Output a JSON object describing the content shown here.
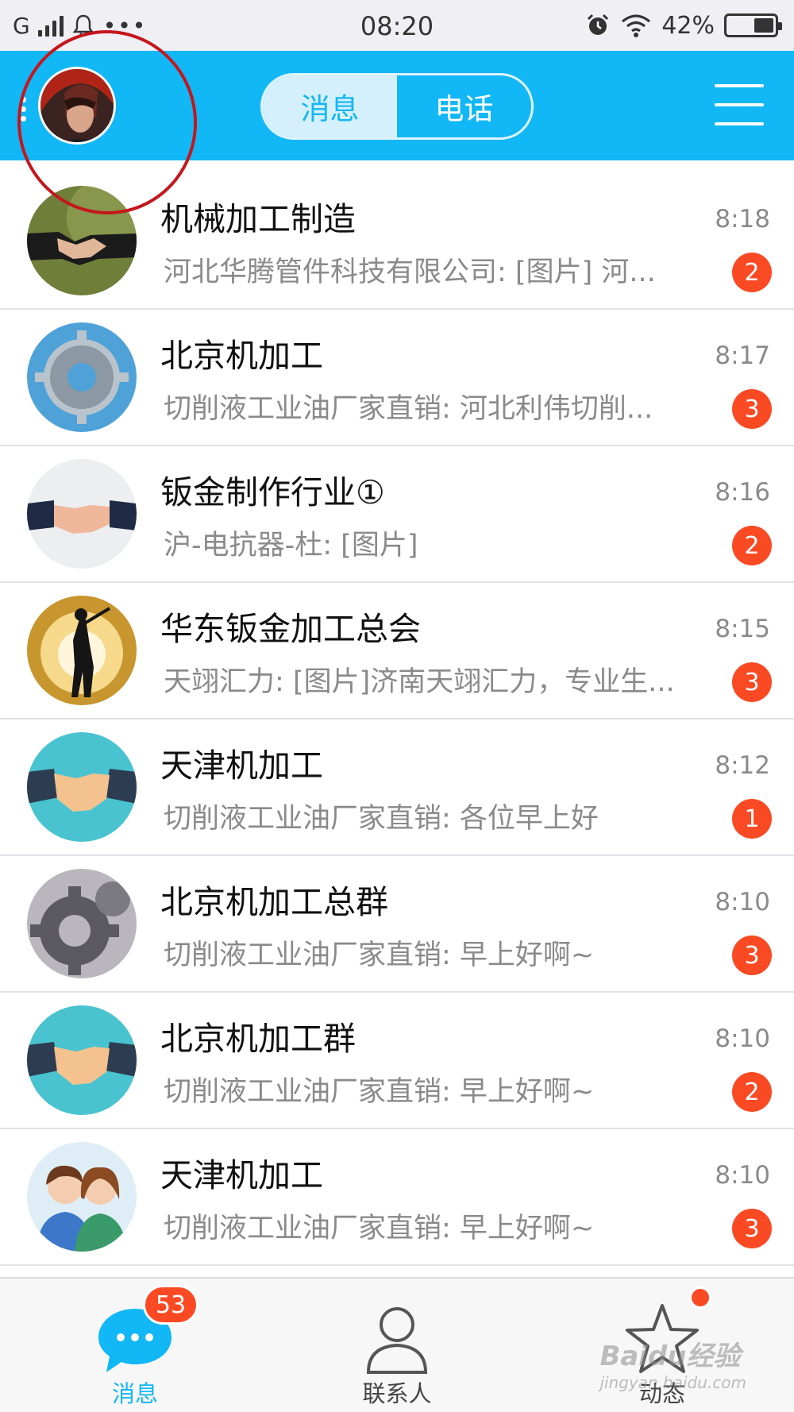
{
  "status_bar": {
    "carrier": "G",
    "dots": "•••",
    "time": "08:20",
    "battery": "42%",
    "battery_level": 0.42
  },
  "header": {
    "tabs": [
      {
        "label": "消息",
        "active": true
      },
      {
        "label": "电话",
        "active": false
      }
    ],
    "accent_color": "#12b7f5"
  },
  "conversations": [
    {
      "title": "机械加工制造",
      "message": "河北华腾管件科技有限公司: [图片] 河...",
      "time": "8:18",
      "unread": "2",
      "avatar": "handshake-green"
    },
    {
      "title": "北京机加工",
      "message": "切削液工业油厂家直销: 河北利伟切削...",
      "time": "8:17",
      "unread": "3",
      "avatar": "gear-blue"
    },
    {
      "title": "钣金制作行业①",
      "message": "沪-电抗器-杜: [图片]",
      "time": "8:16",
      "unread": "2",
      "avatar": "handshake-white"
    },
    {
      "title": "华东钣金加工总会",
      "message": "天翊汇力: [图片]济南天翊汇力，专业生...",
      "time": "8:15",
      "unread": "3",
      "avatar": "golfer-sunset"
    },
    {
      "title": "天津机加工",
      "message": "切削液工业油厂家直销: 各位早上好",
      "time": "8:12",
      "unread": "1",
      "avatar": "handshake-teal"
    },
    {
      "title": "北京机加工总群",
      "message": "切削液工业油厂家直销: 早上好啊~",
      "time": "8:10",
      "unread": "3",
      "avatar": "gear-gray"
    },
    {
      "title": "北京机加工群",
      "message": "切削液工业油厂家直销: 早上好啊~",
      "time": "8:10",
      "unread": "2",
      "avatar": "handshake-teal"
    },
    {
      "title": "天津机加工",
      "message": "切削液工业油厂家直销: 早上好啊~",
      "time": "8:10",
      "unread": "3",
      "avatar": "couple"
    }
  ],
  "tabbar": {
    "items": [
      {
        "label": "消息",
        "icon": "chat-bubble-icon",
        "badge": "53",
        "active": true
      },
      {
        "label": "联系人",
        "icon": "person-icon",
        "active": false
      },
      {
        "label": "动态",
        "icon": "star-icon",
        "dot": true,
        "active": false
      }
    ]
  },
  "watermark": {
    "brand": "Baidu经验",
    "url": "jingyan.baidu.com"
  },
  "colors": {
    "badge": "#fa4a24",
    "annotation": "#c4171d"
  }
}
